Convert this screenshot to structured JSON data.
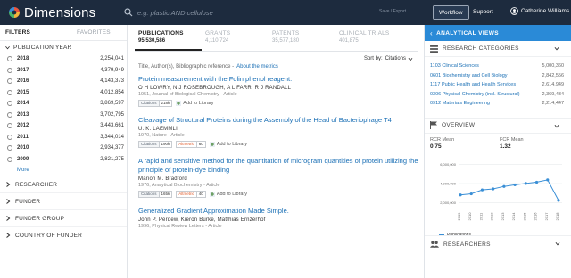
{
  "app": {
    "logo_text": "Dimensions",
    "search_placeholder": "e.g. plastic AND cellulose",
    "save_export": "Save / Export",
    "workflow": "Workflow",
    "support": "Support",
    "user": "Catherine Williams"
  },
  "filters": {
    "tab_filters": "FILTERS",
    "tab_favorites": "FAVORITES",
    "publication_year_label": "PUBLICATION YEAR",
    "years": [
      {
        "year": "2018",
        "count": "2,254,041"
      },
      {
        "year": "2017",
        "count": "4,379,949"
      },
      {
        "year": "2016",
        "count": "4,143,373"
      },
      {
        "year": "2015",
        "count": "4,012,854"
      },
      {
        "year": "2014",
        "count": "3,869,597"
      },
      {
        "year": "2013",
        "count": "3,702,795"
      },
      {
        "year": "2012",
        "count": "3,443,661"
      },
      {
        "year": "2011",
        "count": "3,344,014"
      },
      {
        "year": "2010",
        "count": "2,934,377"
      },
      {
        "year": "2009",
        "count": "2,821,275"
      }
    ],
    "more": "More",
    "groups": [
      "RESEARCHER",
      "FUNDER",
      "FUNDER GROUP",
      "COUNTRY OF FUNDER"
    ]
  },
  "results": {
    "tabs": [
      {
        "label": "PUBLICATIONS",
        "count": "95,530,586"
      },
      {
        "label": "GRANTS",
        "count": "4,110,724"
      },
      {
        "label": "PATENTS",
        "count": "35,577,180"
      },
      {
        "label": "CLINICAL TRIALS",
        "count": "401,875"
      }
    ],
    "sort_label": "Sort by:",
    "sort_value": "Citations",
    "metrics_line": "Title, Author(s), Bibliographic reference -",
    "metrics_link": "About the metrics",
    "add_library": "Add to Library",
    "citations_label": "Citations",
    "altmetric_label": "Altmetric",
    "articles": [
      {
        "title": "Protein measurement with the Folin phenol reagent.",
        "authors": "O H LOWRY, N J ROSEBROUGH, A L FARR, R J RANDALL",
        "meta": "1951, Journal of Biological Chemistry - Article",
        "citations": "218k",
        "altmetric": ""
      },
      {
        "title": "Cleavage of Structural Proteins during the Assembly of the Head of Bacteriophage T4",
        "authors": "U. K. LAEMMLI",
        "meta": "1970, Nature - Article",
        "citations": "190k",
        "altmetric": "60"
      },
      {
        "title": "A rapid and sensitive method for the quantitation of microgram quantities of protein utilizing the principle of protein-dye binding",
        "authors": "Marion M. Bradford",
        "meta": "1976, Analytical Biochemistry - Article",
        "citations": "165k",
        "altmetric": "40"
      },
      {
        "title": "Generalized Gradient Approximation Made Simple.",
        "authors": "John P. Perdew, Kieron Burke, Matthias Ernzerhof",
        "meta": "1996, Physical Review Letters - Article",
        "citations": "",
        "altmetric": ""
      }
    ]
  },
  "analytics": {
    "header": "ANALYTICAL VIEWS",
    "categories_title": "RESEARCH CATEGORIES",
    "categories": [
      {
        "name": "1103 Clinical Sciences",
        "count": "5,000,360"
      },
      {
        "name": "0601 Biochemistry and Cell Biology",
        "count": "2,842,556"
      },
      {
        "name": "1117 Public Health and Health Services",
        "count": "2,614,949"
      },
      {
        "name": "0306 Physical Chemistry (incl. Structural)",
        "count": "2,369,434"
      },
      {
        "name": "0912 Materials Engineering",
        "count": "2,214,447"
      }
    ],
    "overview_title": "OVERVIEW",
    "rcr_label": "RCR Mean",
    "rcr_value": "0.75",
    "fcr_label": "FCR Mean",
    "fcr_value": "1.32",
    "researchers_title": "RESEARCHERS"
  },
  "chart_data": {
    "type": "line",
    "title": "",
    "x": [
      "2009",
      "2010",
      "2011",
      "2012",
      "2013",
      "2014",
      "2015",
      "2016",
      "2017",
      "2018"
    ],
    "yticks": [
      "2,000,000",
      "4,000,000",
      "6,000,000"
    ],
    "ylim": [
      1600000,
      6400000
    ],
    "series": [
      {
        "name": "Publications",
        "values": [
          2821275,
          2934377,
          3344014,
          3443661,
          3702795,
          3869597,
          4012854,
          4143373,
          4379949,
          2254041
        ]
      }
    ],
    "legend_position": "bottom-left",
    "colors": {
      "line": "#3a8fd6"
    }
  }
}
